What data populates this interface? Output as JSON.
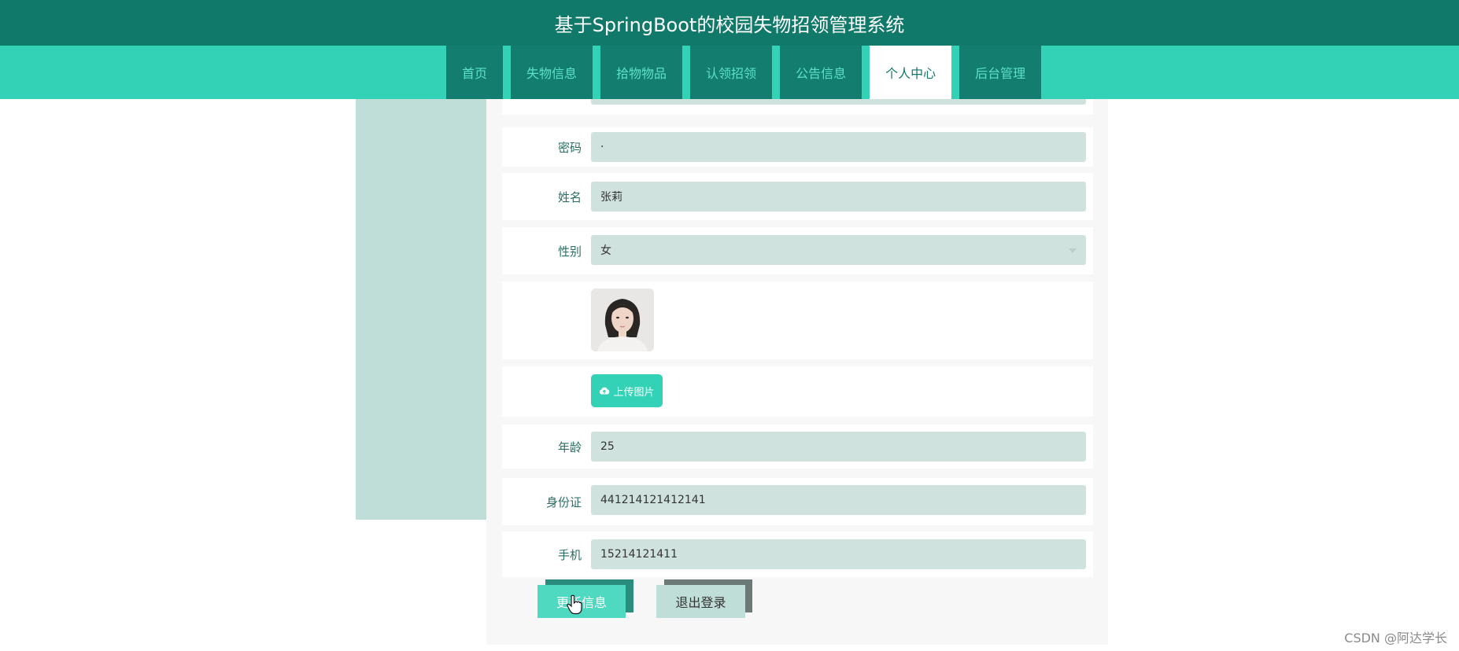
{
  "app": {
    "title": "基于SpringBoot的校园失物招领管理系统"
  },
  "nav": {
    "items": [
      {
        "label": "首页"
      },
      {
        "label": "失物信息"
      },
      {
        "label": "拾物物品"
      },
      {
        "label": "认领招领"
      },
      {
        "label": "公告信息"
      },
      {
        "label": "个人中心",
        "active": true
      },
      {
        "label": "后台管理"
      }
    ]
  },
  "form": {
    "password": {
      "label": "密码",
      "value": "·"
    },
    "name": {
      "label": "姓名",
      "value": "张莉"
    },
    "gender": {
      "label": "性别",
      "value": "女"
    },
    "upload": {
      "label": "上传图片",
      "icon": "cloud-upload-icon"
    },
    "age": {
      "label": "年龄",
      "value": "25"
    },
    "id_card": {
      "label": "身份证",
      "value": "441214121412141"
    },
    "phone": {
      "label": "手机",
      "value": "15214121411"
    }
  },
  "actions": {
    "update_label": "更新信息",
    "logout_label": "退出登录"
  },
  "watermark": "CSDN @阿达学长",
  "colors": {
    "header": "#10796a",
    "navbar": "#33d1b5",
    "nav_item": "#137e6f",
    "field": "#cfe2de",
    "sidebar": "#bfded7",
    "accent": "#33d1b5"
  }
}
